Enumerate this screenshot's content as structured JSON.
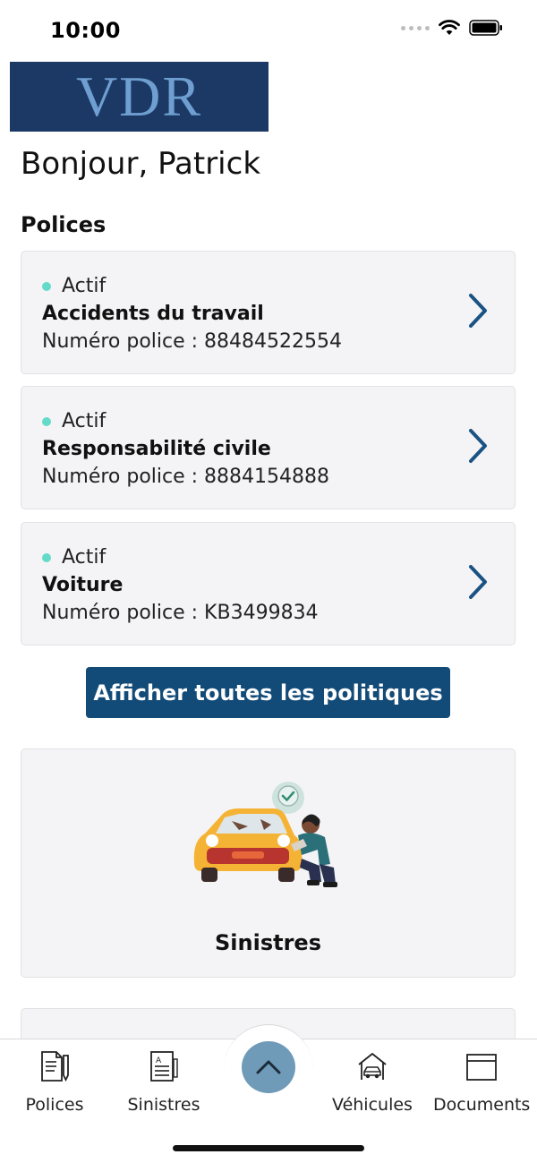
{
  "status_bar": {
    "time": "10:00"
  },
  "logo": {
    "text": "VDR"
  },
  "greeting": "Bonjour, Patrick",
  "policies_section": {
    "title": "Polices",
    "items": [
      {
        "status": "Actif",
        "name": "Accidents du travail",
        "number": "Numéro police : 88484522554"
      },
      {
        "status": "Actif",
        "name": "Responsabilité civile",
        "number": "Numéro police : 8884154888"
      },
      {
        "status": "Actif",
        "name": "Voiture",
        "number": "Numéro police : KB3499834"
      }
    ],
    "view_all_label": "Afficher toutes les politiques"
  },
  "claims_card": {
    "label": "Sinistres",
    "illustration_icon": "car-repair-illustration"
  },
  "bottom_nav": {
    "items": [
      {
        "label": "Polices",
        "icon": "policy-document-icon"
      },
      {
        "label": "Sinistres",
        "icon": "claims-document-icon"
      },
      {
        "label": "Véhicules",
        "icon": "car-house-icon"
      },
      {
        "label": "Documents",
        "icon": "folder-icon"
      }
    ],
    "center_icon": "chevron-up-icon"
  },
  "colors": {
    "brand_navy": "#1c3966",
    "logo_text": "#6e9fd0",
    "primary_button": "#134b78",
    "active_dot": "#63dbc8",
    "chevron": "#1a5283",
    "card_bg": "#f4f4f6",
    "center_button": "#6f9ab8"
  }
}
